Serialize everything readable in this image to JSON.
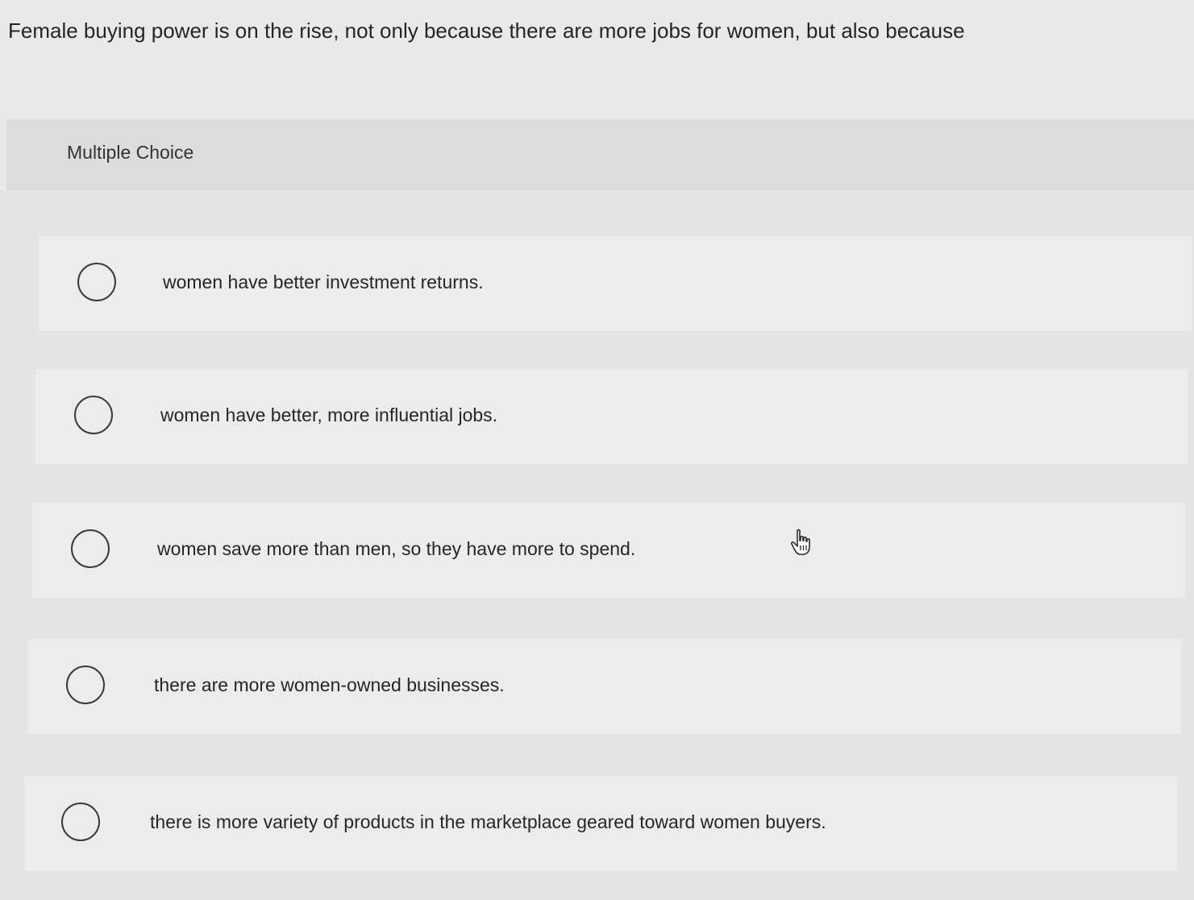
{
  "question": {
    "text": "Female buying power is on the rise, not only because there are more jobs for women, but also because"
  },
  "header": {
    "label": "Multiple Choice"
  },
  "choices": [
    {
      "label": "women have better investment returns.",
      "selected": false
    },
    {
      "label": "women have better, more influential jobs.",
      "selected": false
    },
    {
      "label": "women save more than men, so they have more to spend.",
      "selected": false
    },
    {
      "label": "there are more women-owned businesses.",
      "selected": false
    },
    {
      "label": "there is more variety of products in the marketplace geared toward women buyers.",
      "selected": false
    }
  ],
  "cursor": {
    "icon": "hand-pointer-icon"
  }
}
